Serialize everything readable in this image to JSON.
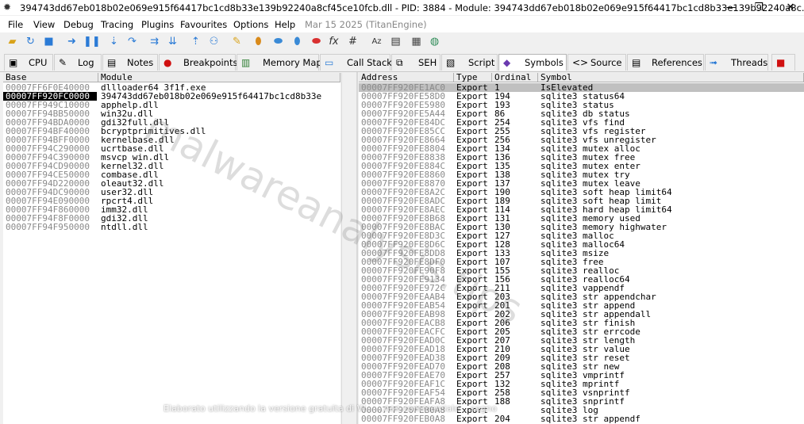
{
  "window": {
    "title": "394743dd67eb018b02e069e915f64417bc1cd8b33e139b92240a8cf45ce10fcb.dll - PID: 3884 - Module: 394743dd67eb018b02e069e915f64417bc1cd8b33e139b92240a8c...",
    "minimize_glyph": "—",
    "maximize_glyph": "❐",
    "close_glyph": "✕"
  },
  "menu": {
    "items": [
      "File",
      "View",
      "Debug",
      "Tracing",
      "Plugins",
      "Favourites",
      "Options",
      "Help"
    ],
    "date": "Mar 15 2025 (TitanEngine)"
  },
  "toolbar_icons": [
    "open-icon",
    "restart-icon",
    "stop-icon",
    "run-icon",
    "pause-icon",
    "step-into-icon",
    "step-over-icon",
    "trace-into-icon",
    "trace-over-icon",
    "execute-till-return-icon",
    "run-to-user-code-icon",
    "comment-icon",
    "label-icon",
    "bookmark-icon",
    "function-icon",
    "hash-icon",
    "font-icon",
    "calculator-icon",
    "globe-icon"
  ],
  "tabs": [
    {
      "label": "CPU",
      "icon": "cpu-icon"
    },
    {
      "label": "Log",
      "icon": "log-icon"
    },
    {
      "label": "Notes",
      "icon": "notes-icon"
    },
    {
      "label": "Breakpoints",
      "icon": "breakpoint-icon"
    },
    {
      "label": "Memory Map",
      "icon": "memory-map-icon"
    },
    {
      "label": "Call Stack",
      "icon": "call-stack-icon"
    },
    {
      "label": "SEH",
      "icon": "seh-icon"
    },
    {
      "label": "Script",
      "icon": "script-icon"
    },
    {
      "label": "Symbols",
      "icon": "symbols-icon"
    },
    {
      "label": "Source",
      "icon": "source-icon"
    },
    {
      "label": "References",
      "icon": "references-icon"
    },
    {
      "label": "Threads",
      "icon": "threads-icon"
    }
  ],
  "modules": {
    "headers": [
      "Base",
      "Module"
    ],
    "rows": [
      {
        "base": "00007FF6F0E40000",
        "module": "dllloader64_3f1f.exe"
      },
      {
        "base": "00007FF920FC0000",
        "module": "394743dd67eb018b02e069e915f64417bc1cd8b33e"
      },
      {
        "base": "00007FF949C10000",
        "module": "apphelp.dll"
      },
      {
        "base": "00007FF94BB50000",
        "module": "win32u.dll"
      },
      {
        "base": "00007FF94BDA0000",
        "module": "gdi32full.dll"
      },
      {
        "base": "00007FF94BF40000",
        "module": "bcryptprimitives.dll"
      },
      {
        "base": "00007FF94BFF0000",
        "module": "kernelbase.dll"
      },
      {
        "base": "00007FF94C290000",
        "module": "ucrtbase.dll"
      },
      {
        "base": "00007FF94C390000",
        "module": "msvcp_win.dll"
      },
      {
        "base": "00007FF94CD90000",
        "module": "kernel32.dll"
      },
      {
        "base": "00007FF94CE50000",
        "module": "combase.dll"
      },
      {
        "base": "00007FF94D220000",
        "module": "oleaut32.dll"
      },
      {
        "base": "00007FF94DC90000",
        "module": "user32.dll"
      },
      {
        "base": "00007FF94E090000",
        "module": "rpcrt4.dll"
      },
      {
        "base": "00007FF94F860000",
        "module": "imm32.dll"
      },
      {
        "base": "00007FF94F8F0000",
        "module": "gdi32.dll"
      },
      {
        "base": "00007FF94F950000",
        "module": "ntdll.dll"
      }
    ],
    "selected_index": 1
  },
  "symbols": {
    "headers": [
      "Address",
      "Type",
      "Ordinal",
      "Symbol"
    ],
    "rows": [
      {
        "address": "00007FF920FE1AC0",
        "type": "Export",
        "ordinal": "1",
        "symbol": "IsElevated"
      },
      {
        "address": "00007FF920FE58D0",
        "type": "Export",
        "ordinal": "194",
        "symbol": "sqlite3_status64"
      },
      {
        "address": "00007FF920FE5980",
        "type": "Export",
        "ordinal": "193",
        "symbol": "sqlite3_status"
      },
      {
        "address": "00007FF920FE5A44",
        "type": "Export",
        "ordinal": "86",
        "symbol": "sqlite3_db_status"
      },
      {
        "address": "00007FF920FE84DC",
        "type": "Export",
        "ordinal": "254",
        "symbol": "sqlite3_vfs_find"
      },
      {
        "address": "00007FF920FE85CC",
        "type": "Export",
        "ordinal": "255",
        "symbol": "sqlite3_vfs_register"
      },
      {
        "address": "00007FF920FE8664",
        "type": "Export",
        "ordinal": "256",
        "symbol": "sqlite3_vfs_unregister"
      },
      {
        "address": "00007FF920FE8804",
        "type": "Export",
        "ordinal": "134",
        "symbol": "sqlite3_mutex_alloc"
      },
      {
        "address": "00007FF920FE8838",
        "type": "Export",
        "ordinal": "136",
        "symbol": "sqlite3_mutex_free"
      },
      {
        "address": "00007FF920FE884C",
        "type": "Export",
        "ordinal": "135",
        "symbol": "sqlite3_mutex_enter"
      },
      {
        "address": "00007FF920FE8860",
        "type": "Export",
        "ordinal": "138",
        "symbol": "sqlite3_mutex_try"
      },
      {
        "address": "00007FF920FE8870",
        "type": "Export",
        "ordinal": "137",
        "symbol": "sqlite3_mutex_leave"
      },
      {
        "address": "00007FF920FE8A2C",
        "type": "Export",
        "ordinal": "190",
        "symbol": "sqlite3_soft_heap_limit64"
      },
      {
        "address": "00007FF920FE8ADC",
        "type": "Export",
        "ordinal": "189",
        "symbol": "sqlite3_soft_heap_limit"
      },
      {
        "address": "00007FF920FE8AEC",
        "type": "Export",
        "ordinal": "114",
        "symbol": "sqlite3_hard_heap_limit64"
      },
      {
        "address": "00007FF920FE8B68",
        "type": "Export",
        "ordinal": "131",
        "symbol": "sqlite3_memory_used"
      },
      {
        "address": "00007FF920FE8BAC",
        "type": "Export",
        "ordinal": "130",
        "symbol": "sqlite3_memory_highwater"
      },
      {
        "address": "00007FF920FE8D3C",
        "type": "Export",
        "ordinal": "127",
        "symbol": "sqlite3_malloc"
      },
      {
        "address": "00007FF920FE8D6C",
        "type": "Export",
        "ordinal": "128",
        "symbol": "sqlite3_malloc64"
      },
      {
        "address": "00007FF920FE8DD8",
        "type": "Export",
        "ordinal": "133",
        "symbol": "sqlite3_msize"
      },
      {
        "address": "00007FF920FE8DF0",
        "type": "Export",
        "ordinal": "107",
        "symbol": "sqlite3_free"
      },
      {
        "address": "00007FF920FE90F8",
        "type": "Export",
        "ordinal": "155",
        "symbol": "sqlite3_realloc"
      },
      {
        "address": "00007FF920FE9134",
        "type": "Export",
        "ordinal": "156",
        "symbol": "sqlite3_realloc64"
      },
      {
        "address": "00007FF920FE972C",
        "type": "Export",
        "ordinal": "211",
        "symbol": "sqlite3_vappendf"
      },
      {
        "address": "00007FF920FEAAB4",
        "type": "Export",
        "ordinal": "203",
        "symbol": "sqlite3_str_appendchar"
      },
      {
        "address": "00007FF920FEAB54",
        "type": "Export",
        "ordinal": "201",
        "symbol": "sqlite3_str_append"
      },
      {
        "address": "00007FF920FEAB98",
        "type": "Export",
        "ordinal": "202",
        "symbol": "sqlite3_str_appendall"
      },
      {
        "address": "00007FF920FEACB8",
        "type": "Export",
        "ordinal": "206",
        "symbol": "sqlite3_str_finish"
      },
      {
        "address": "00007FF920FEACFC",
        "type": "Export",
        "ordinal": "205",
        "symbol": "sqlite3_str_errcode"
      },
      {
        "address": "00007FF920FEAD0C",
        "type": "Export",
        "ordinal": "207",
        "symbol": "sqlite3_str_length"
      },
      {
        "address": "00007FF920FEAD18",
        "type": "Export",
        "ordinal": "210",
        "symbol": "sqlite3_str_value"
      },
      {
        "address": "00007FF920FEAD38",
        "type": "Export",
        "ordinal": "209",
        "symbol": "sqlite3_str_reset"
      },
      {
        "address": "00007FF920FEAD70",
        "type": "Export",
        "ordinal": "208",
        "symbol": "sqlite3_str_new"
      },
      {
        "address": "00007FF920FEAE70",
        "type": "Export",
        "ordinal": "257",
        "symbol": "sqlite3_vmprintf"
      },
      {
        "address": "00007FF920FEAF1C",
        "type": "Export",
        "ordinal": "132",
        "symbol": "sqlite3_mprintf"
      },
      {
        "address": "00007FF920FEAF54",
        "type": "Export",
        "ordinal": "258",
        "symbol": "sqlite3_vsnprintf"
      },
      {
        "address": "00007FF920FEAFA8",
        "type": "Export",
        "ordinal": "188",
        "symbol": "sqlite3_snprintf"
      },
      {
        "address": "00007FF920FEB0A8",
        "type": "Export",
        "ordinal": "",
        "symbol": "sqlite3_log"
      },
      {
        "address": "00007FF920FEB0A8",
        "type": "Export",
        "ordinal": "204",
        "symbol": "sqlite3_str_appendf"
      }
    ],
    "selected_index": 0
  },
  "watermark": "malwareanalysis.tips",
  "footnote": "Elaborato utilizzando la versione gratuita di W... ...non commerciale ...segno",
  "colors": {
    "selected_row": "#c0c0c0",
    "selected_module_base_bg": "#000000",
    "grey_text": "#8a8a8a"
  }
}
